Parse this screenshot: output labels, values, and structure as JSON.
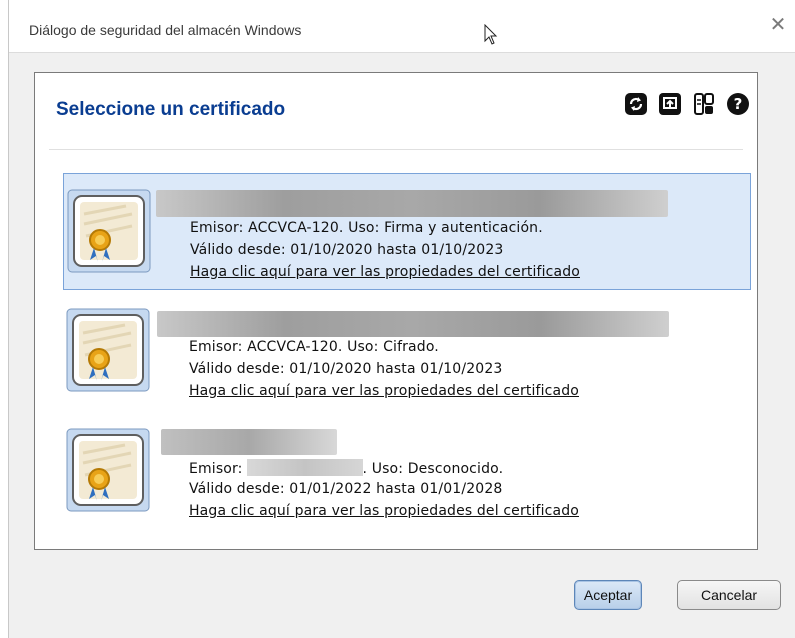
{
  "window": {
    "title": "Diálogo de seguridad del almacén Windows"
  },
  "panel": {
    "title": "Seleccione un certificado",
    "toolbar": [
      {
        "icon": "refresh-icon"
      },
      {
        "icon": "import-icon"
      },
      {
        "icon": "view-icon"
      },
      {
        "icon": "help-icon"
      }
    ]
  },
  "certificates": [
    {
      "issuer_label": "Emisor: ACCVCA-120. Uso: Firma y autenticación.",
      "validity": "Válido desde: 01/10/2020 hasta 01/10/2023",
      "link": "Haga clic aquí para ver las propiedades del certificado",
      "selected": true
    },
    {
      "issuer_label": "Emisor: ACCVCA-120. Uso: Cifrado.",
      "validity": "Válido desde: 01/10/2020 hasta 01/10/2023",
      "link": "Haga clic aquí para ver las propiedades del certificado",
      "selected": false
    },
    {
      "issuer_prefix": "Emisor:",
      "issuer_suffix": ". Uso: Desconocido.",
      "validity": "Válido desde: 01/01/2022 hasta 01/01/2028",
      "link": "Haga clic aquí para ver las propiedades del certificado",
      "selected": false
    }
  ],
  "buttons": {
    "ok": "Aceptar",
    "cancel": "Cancelar"
  },
  "colors": {
    "title_blue": "#0a3d91",
    "selected_bg": "#dce9f9",
    "selected_border": "#7aa3d9"
  }
}
